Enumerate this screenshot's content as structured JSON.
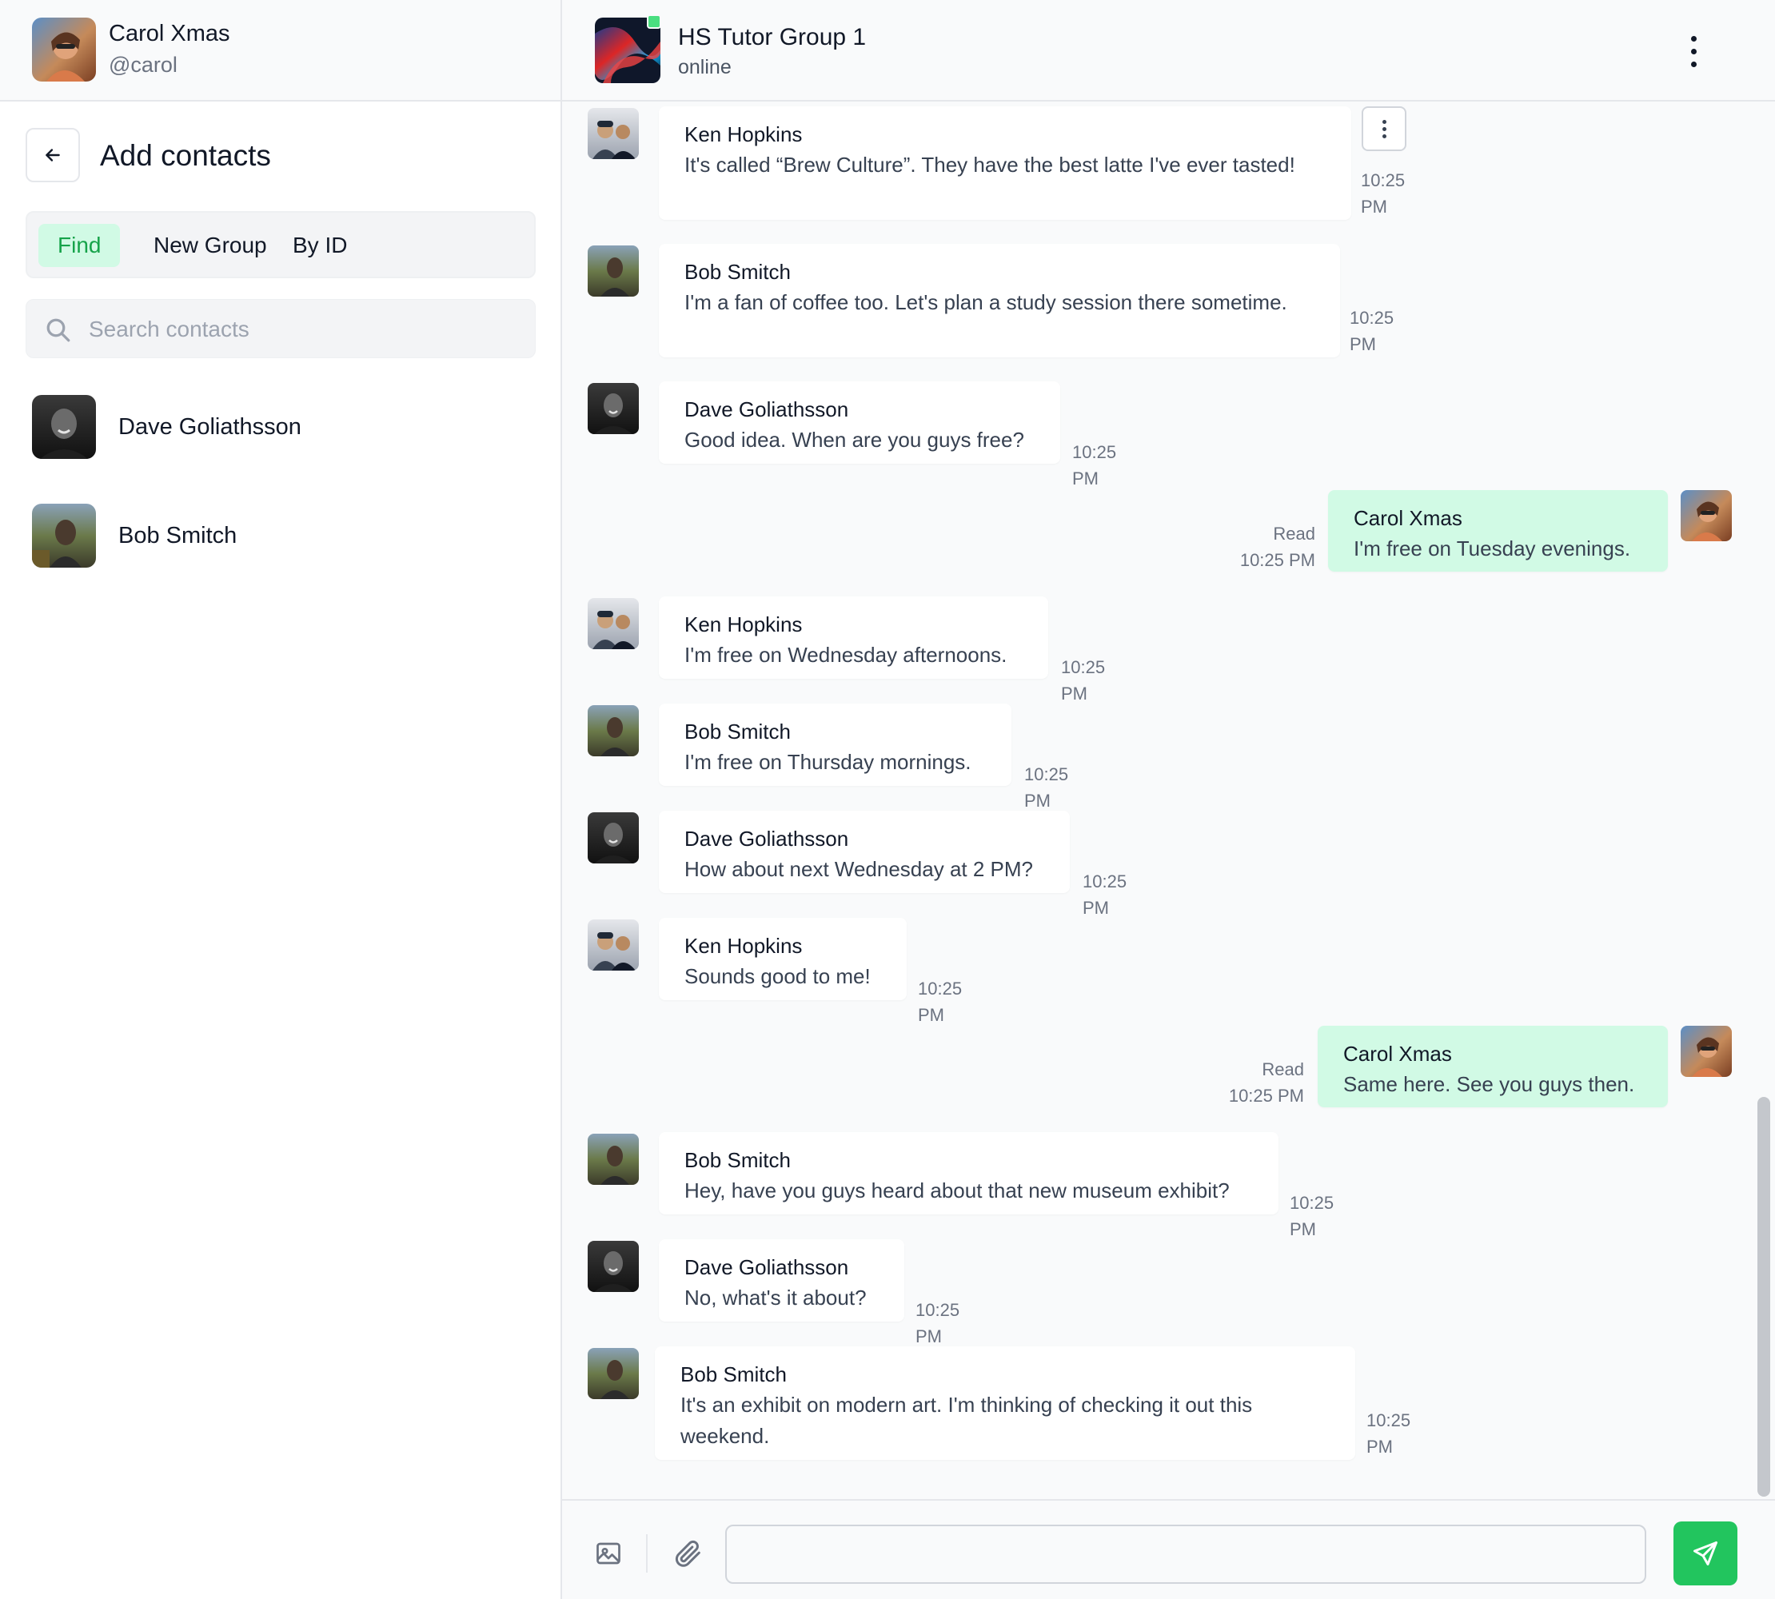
{
  "me": {
    "name": "Carol Xmas",
    "handle": "@carol"
  },
  "panel": {
    "title": "Add contacts"
  },
  "tabs": [
    {
      "label": "Find"
    },
    {
      "label": "New Group"
    },
    {
      "label": "By ID"
    }
  ],
  "search": {
    "placeholder": "Search contacts",
    "value": ""
  },
  "contacts": [
    {
      "name": "Dave Goliathsson",
      "avatar": "dave-avatar"
    },
    {
      "name": "Bob Smitch",
      "avatar": "bob-avatar"
    }
  ],
  "chat": {
    "title": "HS Tutor Group 1",
    "status": "online"
  },
  "messages": [
    {
      "sender": "Ken Hopkins",
      "text": "It's called “Brew Culture”. They have the best latte I've ever tasted!",
      "time": "10:25 PM",
      "mine": false
    },
    {
      "sender": "Bob Smitch",
      "text": "I'm a fan of coffee too. Let's plan a study session there sometime.",
      "time": "10:25 PM",
      "mine": false
    },
    {
      "sender": "Dave Goliathsson",
      "text": "Good idea. When are you guys free?",
      "time": "10:25 PM",
      "mine": false
    },
    {
      "sender": "Carol Xmas",
      "text": "I'm free on Tuesday evenings.",
      "time": "10:25 PM",
      "status": "Read",
      "mine": true
    },
    {
      "sender": "Ken Hopkins",
      "text": "I'm free on Wednesday afternoons.",
      "time": "10:25 PM",
      "mine": false
    },
    {
      "sender": "Bob Smitch",
      "text": "I'm free on Thursday mornings.",
      "time": "10:25 PM",
      "mine": false
    },
    {
      "sender": "Dave Goliathsson",
      "text": "How about next Wednesday at 2 PM?",
      "time": "10:25 PM",
      "mine": false
    },
    {
      "sender": "Ken Hopkins",
      "text": "Sounds good to me!",
      "time": "10:25 PM",
      "mine": false
    },
    {
      "sender": "Carol Xmas",
      "text": "Same here. See you guys then.",
      "time": "10:25 PM",
      "status": "Read",
      "mine": true
    },
    {
      "sender": "Bob Smitch",
      "text": "Hey, have you guys heard about that new museum exhibit?",
      "time": "10:25 PM",
      "mine": false
    },
    {
      "sender": "Dave Goliathsson",
      "text": "No, what's it about?",
      "time": "10:25 PM",
      "mine": false
    },
    {
      "sender": "Bob Smitch",
      "text": "It's an exhibit on modern art. I'm thinking of checking it out this weekend.",
      "time": "10:25 PM",
      "mine": false
    }
  ],
  "composer": {
    "value": ""
  },
  "colors": {
    "accent": "#22c55e",
    "mine_bubble": "#d1fae5",
    "tab_active_bg": "#d1fae5",
    "tab_active_text": "#16a34a",
    "online": "#4ade80"
  },
  "icons": {
    "back": "arrow-left-icon",
    "search": "search-icon",
    "more": "more-vertical-icon",
    "image": "image-icon",
    "attach": "paperclip-icon",
    "send": "send-icon"
  }
}
